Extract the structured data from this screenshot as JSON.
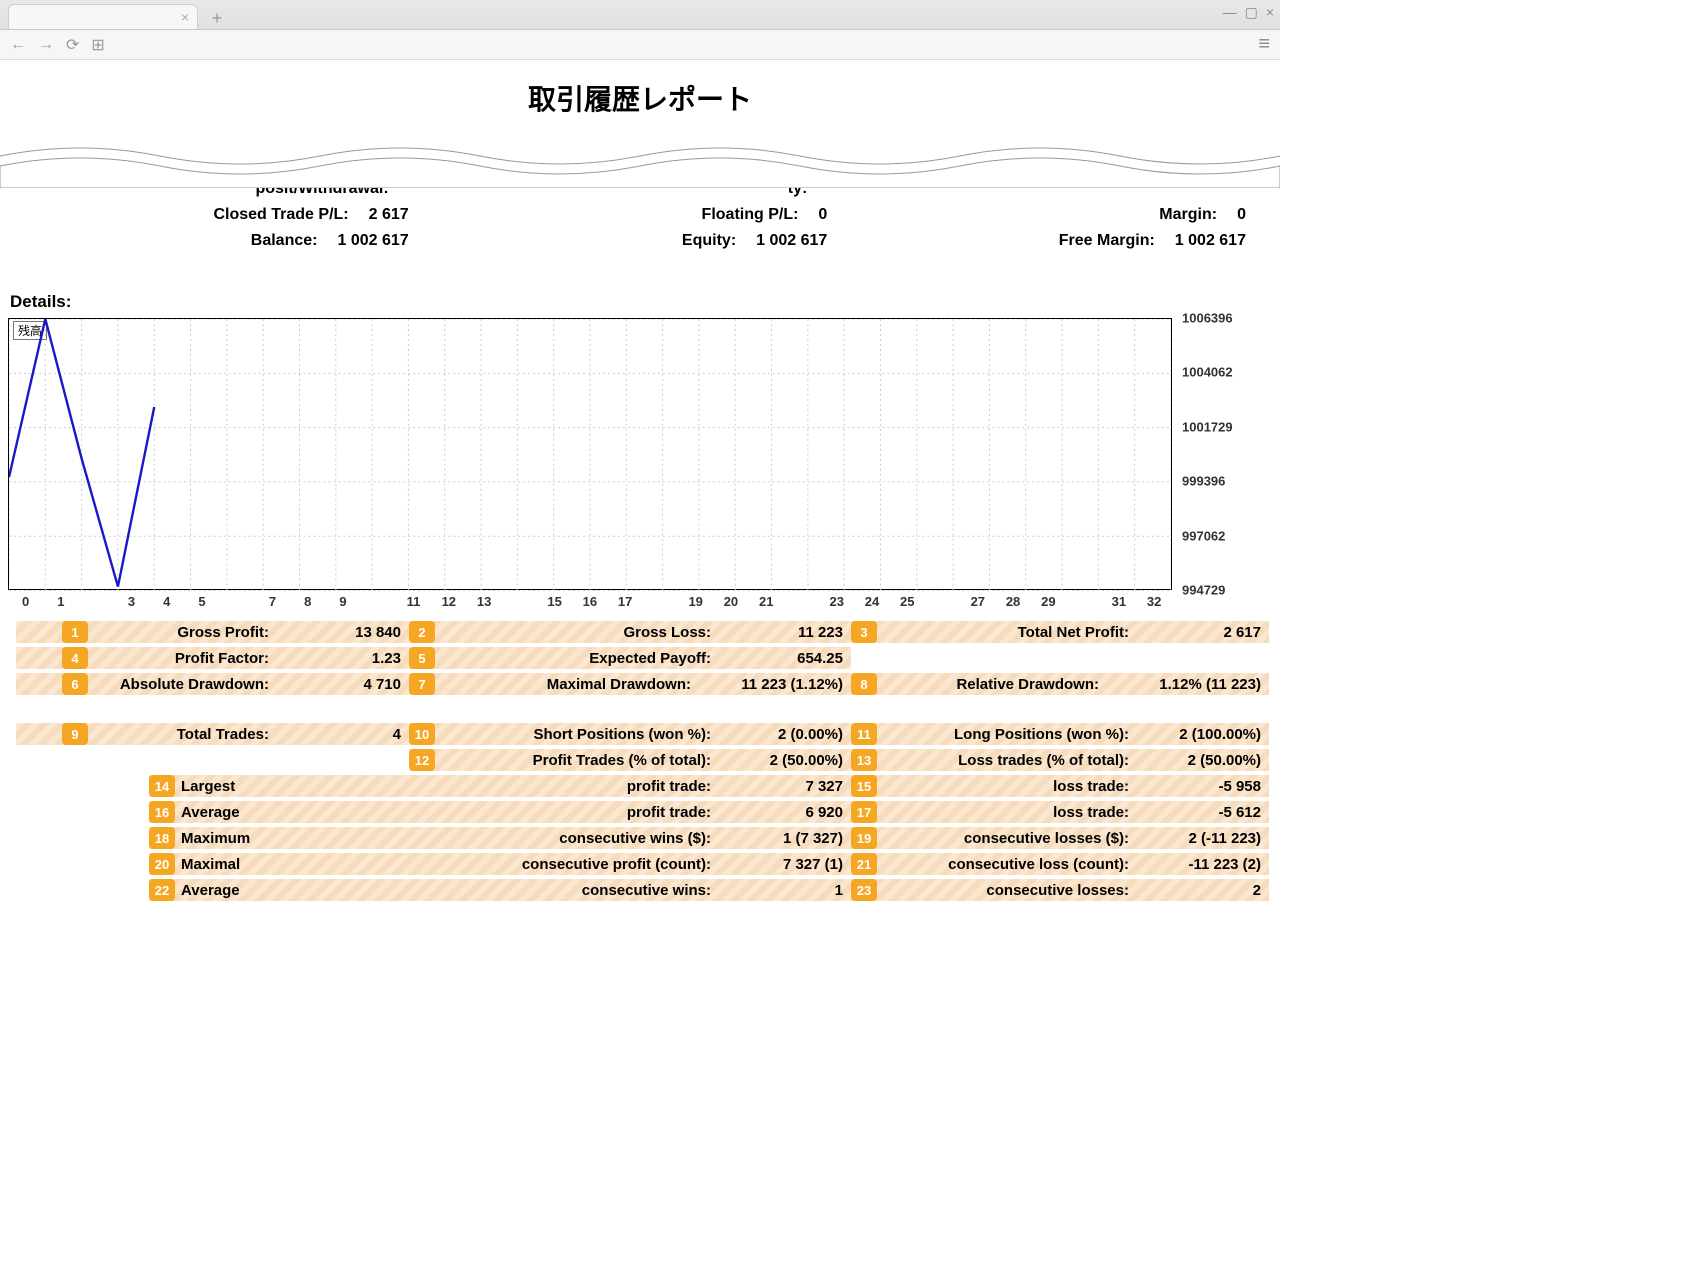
{
  "browser": {
    "tab_close": "×",
    "new_tab": "+",
    "window_min": "—",
    "window_max": "▢",
    "window_close": "×",
    "back": "←",
    "forward": "→",
    "reload": "⟳",
    "apps": "⊞",
    "menu": "≡"
  },
  "title": "取引履歴レポート",
  "summary": {
    "row1": {
      "c1_label": "posit/Withdrawal:",
      "c1_value": "",
      "c2_label": "ty:",
      "c2_value": "",
      "c3_label": "",
      "c3_value": ""
    },
    "row2": {
      "c1_label": "Closed Trade P/L:",
      "c1_value": "2 617",
      "c2_label": "Floating P/L:",
      "c2_value": "0",
      "c3_label": "Margin:",
      "c3_value": "0"
    },
    "row3": {
      "c1_label": "Balance:",
      "c1_value": "1 002 617",
      "c2_label": "Equity:",
      "c2_value": "1 002 617",
      "c3_label": "Free Margin:",
      "c3_value": "1 002 617"
    }
  },
  "details_header": "Details:",
  "chart_legend": "残高",
  "chart_data": {
    "type": "line",
    "title": "",
    "xlabel": "",
    "ylabel": "",
    "x": [
      0,
      1,
      2,
      3,
      4
    ],
    "values": [
      999600,
      1006396,
      1000400,
      994900,
      1002617
    ],
    "ylim": [
      994729,
      1006396
    ],
    "xlim": [
      0,
      32
    ],
    "x_ticks": [
      0,
      1,
      3,
      4,
      5,
      7,
      8,
      9,
      11,
      12,
      13,
      15,
      16,
      17,
      19,
      20,
      21,
      23,
      24,
      25,
      27,
      28,
      29,
      31,
      32
    ],
    "y_ticks": [
      1006396,
      1004062,
      1001729,
      999396,
      997062,
      994729
    ]
  },
  "details": {
    "r1": {
      "n": "1",
      "label": "Gross Profit:",
      "value": "13 840"
    },
    "r2": {
      "n": "2",
      "label": "Gross Loss:",
      "value": "11 223"
    },
    "r3": {
      "n": "3",
      "label": "Total Net Profit:",
      "value": "2 617"
    },
    "r4": {
      "n": "4",
      "label": "Profit Factor:",
      "value": "1.23"
    },
    "r5": {
      "n": "5",
      "label": "Expected Payoff:",
      "value": "654.25"
    },
    "r6": {
      "n": "6",
      "label": "Absolute Drawdown:",
      "value": "4 710"
    },
    "r7": {
      "n": "7",
      "label": "Maximal Drawdown:",
      "value": "11 223 (1.12%)"
    },
    "r8": {
      "n": "8",
      "label": "Relative Drawdown:",
      "value": "1.12% (11 223)"
    },
    "r9": {
      "n": "9",
      "label": "Total Trades:",
      "value": "4"
    },
    "r10": {
      "n": "10",
      "label": "Short Positions (won %):",
      "value": "2 (0.00%)"
    },
    "r11": {
      "n": "11",
      "label": "Long Positions (won %):",
      "value": "2 (100.00%)"
    },
    "r12": {
      "n": "12",
      "label": "Profit Trades (% of total):",
      "value": "2 (50.00%)"
    },
    "r13": {
      "n": "13",
      "label": "Loss trades (% of total):",
      "value": "2 (50.00%)"
    },
    "r14": {
      "n": "14",
      "lead": "Largest",
      "label": "profit trade:",
      "value": "7 327"
    },
    "r15": {
      "n": "15",
      "label": "loss trade:",
      "value": "-5 958"
    },
    "r16": {
      "n": "16",
      "lead": "Average",
      "label": "profit trade:",
      "value": "6 920"
    },
    "r17": {
      "n": "17",
      "label": "loss trade:",
      "value": "-5 612"
    },
    "r18": {
      "n": "18",
      "lead": "Maximum",
      "label": "consecutive wins ($):",
      "value": "1 (7 327)"
    },
    "r19": {
      "n": "19",
      "label": "consecutive losses ($):",
      "value": "2 (-11 223)"
    },
    "r20": {
      "n": "20",
      "lead": "Maximal",
      "label": "consecutive profit (count):",
      "value": "7 327 (1)"
    },
    "r21": {
      "n": "21",
      "label": "consecutive loss (count):",
      "value": "-11 223 (2)"
    },
    "r22": {
      "n": "22",
      "lead": "Average",
      "label": "consecutive wins:",
      "value": "1"
    },
    "r23": {
      "n": "23",
      "label": "consecutive losses:",
      "value": "2"
    }
  }
}
